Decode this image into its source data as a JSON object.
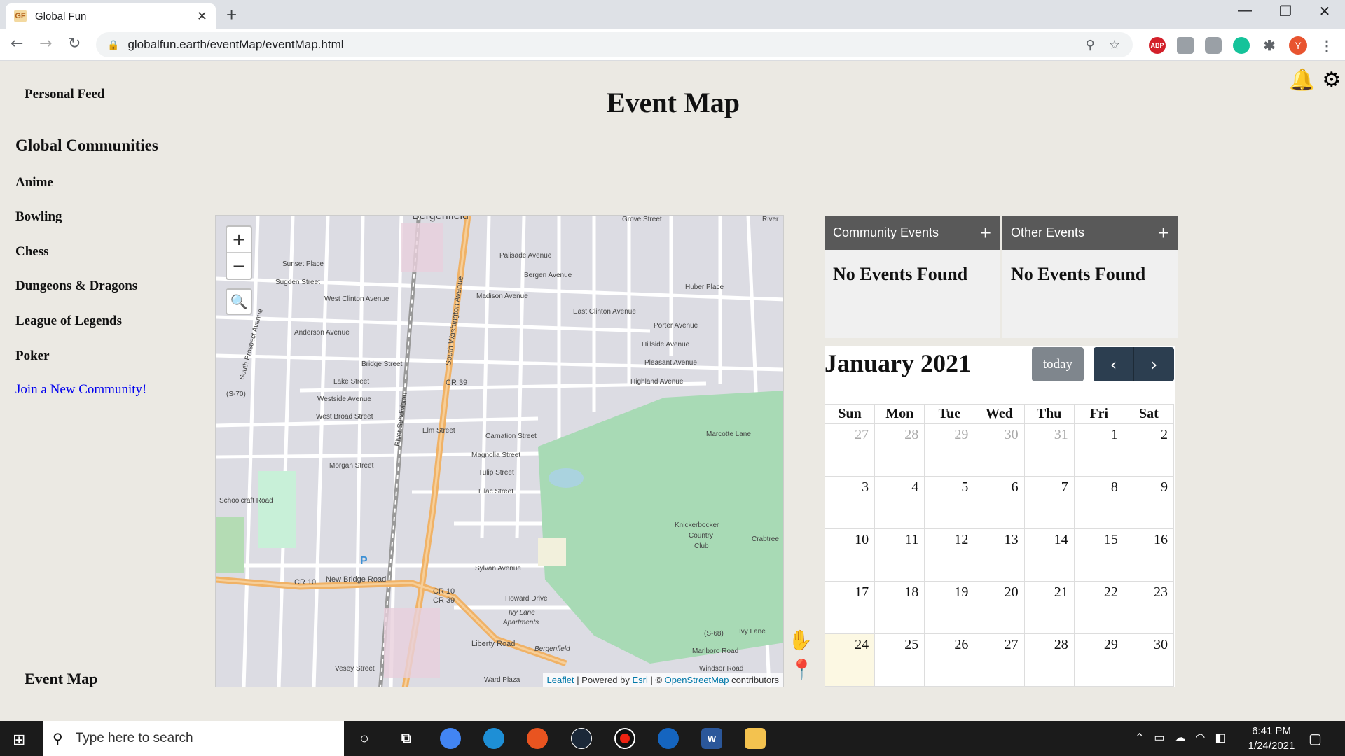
{
  "browser": {
    "tab_title": "Global Fun",
    "favicon_text": "GF",
    "url": "globalfun.earth/eventMap/eventMap.html",
    "profile_initial": "Y",
    "extension_labels": [
      "ABP"
    ]
  },
  "sidebar": {
    "personal_feed": "Personal Feed",
    "communities_heading": "Global Communities",
    "communities": [
      "Anime",
      "Bowling",
      "Chess",
      "Dungeons & Dragons",
      "League of Legends",
      "Poker"
    ],
    "join_link": "Join a New Community!",
    "event_map": "Event Map"
  },
  "page": {
    "title": "Event Map"
  },
  "map": {
    "zoom_in": "+",
    "zoom_out": "−",
    "attribution": {
      "leaflet": "Leaflet",
      "powered_by": "| Powered by",
      "esri": "Esri",
      "sep": "| ©",
      "osm": "OpenStreetMap",
      "contributors": "contributors"
    },
    "labels": {
      "bergenfield": "Bergenfield",
      "grove": "Grove Street",
      "river": "River",
      "sunset": "Sunset Place",
      "sugden": "Sugden Street",
      "west_clinton": "West Clinton Avenue",
      "palisade": "Palisade Avenue",
      "bergen": "Bergen Avenue",
      "madison": "Madison Avenue",
      "east_clinton": "East Clinton Avenue",
      "huber": "Huber Place",
      "porter": "Porter Avenue",
      "hillside": "Hillside Avenue",
      "pleasant": "Pleasant Avenue",
      "highland": "Highland Avenue",
      "anderson": "Anderson Avenue",
      "bridge": "Bridge Street",
      "lake": "Lake Street",
      "westside": "Westside Avenue",
      "west_broad": "West Broad Street",
      "s70": "(S-70)",
      "cr39": "CR 39",
      "elm": "Elm Street",
      "carnation": "Carnation Street",
      "magnolia": "Magnolia Street",
      "tulip": "Tulip Street",
      "lilac": "Lilac Street",
      "morgan": "Morgan Street",
      "schoolcraft": "Schoolcraft Road",
      "marcotte": "Marcotte Lane",
      "knickerbocker": "Knickerbocker",
      "country": "Country",
      "club": "Club",
      "crabtree": "Crabtree",
      "sylvan": "Sylvan Avenue",
      "cr10": "CR 10",
      "new_bridge": "New Bridge Road",
      "cr10b": "CR 10",
      "cr39b": "CR 39",
      "howard": "Howard Drive",
      "ivy_lane_apts_1": "Ivy Lane",
      "ivy_lane_apts_2": "Apartments",
      "liberty": "Liberty Road",
      "bergenfield_road": "Bergenfield",
      "s68": "(S-68)",
      "ivy_lane": "Ivy Lane",
      "marlboro": "Marlboro Road",
      "windsor": "Windsor Road",
      "vesey": "Vesey Street",
      "ward": "Ward Plaza",
      "south_washington": "South Washington Avenue",
      "south_prospect": "South Prospect Avenue",
      "river_subdivision": "River Subdivision",
      "parking": "P"
    }
  },
  "community_events": {
    "title": "Community Events",
    "empty": "No Events Found"
  },
  "other_events": {
    "title": "Other Events",
    "empty": "No Events Found"
  },
  "calendar": {
    "title": "January 2021",
    "today_label": "today",
    "weekdays": [
      "Sun",
      "Mon",
      "Tue",
      "Wed",
      "Thu",
      "Fri",
      "Sat"
    ],
    "weeks": [
      [
        "27",
        "28",
        "29",
        "30",
        "31",
        "1",
        "2"
      ],
      [
        "3",
        "4",
        "5",
        "6",
        "7",
        "8",
        "9"
      ],
      [
        "10",
        "11",
        "12",
        "13",
        "14",
        "15",
        "16"
      ],
      [
        "17",
        "18",
        "19",
        "20",
        "21",
        "22",
        "23"
      ],
      [
        "24",
        "25",
        "26",
        "27",
        "28",
        "29",
        "30"
      ]
    ],
    "other_month_cells": [
      "0-0",
      "0-1",
      "0-2",
      "0-3",
      "0-4"
    ],
    "today_cell": "4-0"
  },
  "taskbar": {
    "search_placeholder": "Type here to search",
    "time": "6:41 PM",
    "date": "1/24/2021",
    "word_label": "W"
  },
  "colors": {
    "page_bg": "#ebe9e3",
    "panel_header": "#595959",
    "calendar_nav": "#2c3e50",
    "today_button": "#7f868d",
    "today_highlight": "#fcf8e3",
    "link": "#0000ee",
    "map_park": "#a8dab5",
    "map_road_major": "#f0b266"
  }
}
